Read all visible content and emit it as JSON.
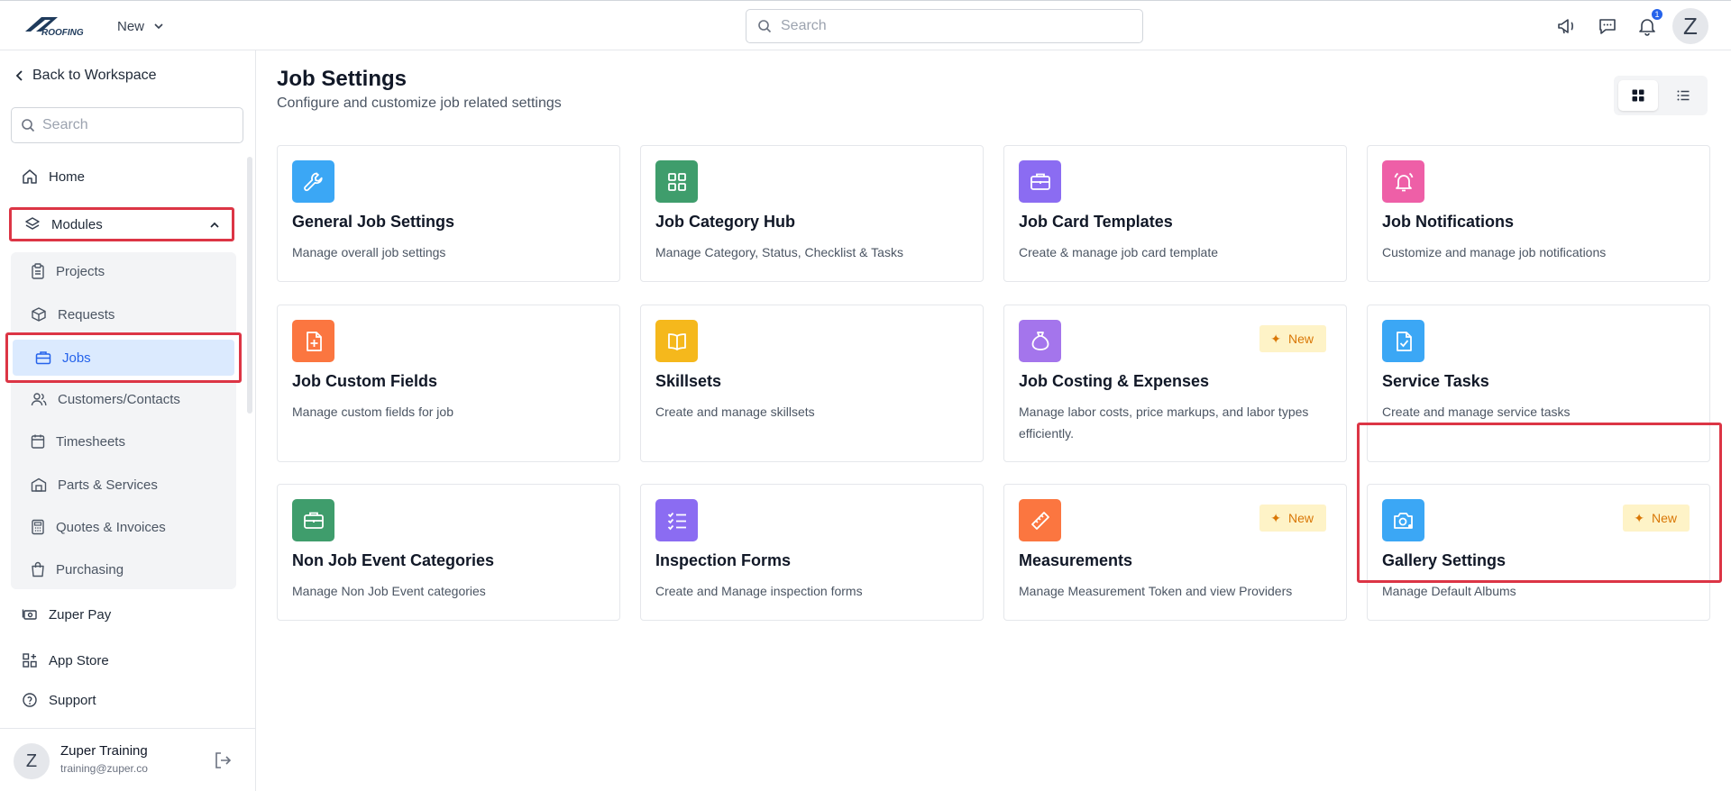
{
  "topbar": {
    "logo_text": "ROOFING",
    "new_label": "New",
    "search_placeholder": "Search",
    "notification_count": "1",
    "avatar_initial": "Z"
  },
  "sidebar": {
    "back_label": "Back to Workspace",
    "search_placeholder": "Search",
    "home_label": "Home",
    "modules_label": "Modules",
    "submenu": [
      {
        "label": "Projects",
        "icon": "clipboard-icon"
      },
      {
        "label": "Requests",
        "icon": "box-icon"
      },
      {
        "label": "Jobs",
        "icon": "briefcase-icon"
      },
      {
        "label": "Customers/Contacts",
        "icon": "users-icon"
      },
      {
        "label": "Timesheets",
        "icon": "calendar-icon"
      },
      {
        "label": "Parts & Services",
        "icon": "warehouse-icon"
      },
      {
        "label": "Quotes & Invoices",
        "icon": "calculator-icon"
      },
      {
        "label": "Purchasing",
        "icon": "shopping-bag-icon"
      }
    ],
    "zuper_pay_label": "Zuper Pay",
    "app_store_label": "App Store",
    "support_label": "Support",
    "user": {
      "initial": "Z",
      "name": "Zuper Training",
      "email": "training@zuper.co"
    }
  },
  "main": {
    "title": "Job Settings",
    "subtitle": "Configure and customize job related settings",
    "new_badge_label": "New",
    "cards": [
      {
        "title": "General Job Settings",
        "desc": "Manage overall job settings",
        "color": "#3ba7f5",
        "icon": "wrench-icon"
      },
      {
        "title": "Job Category Hub",
        "desc": "Manage Category, Status, Checklist & Tasks",
        "color": "#3f9d6c",
        "icon": "grid-icon"
      },
      {
        "title": "Job Card Templates",
        "desc": "Create & manage job card template",
        "color": "#8b6cf2",
        "icon": "briefcase-icon"
      },
      {
        "title": "Job Notifications",
        "desc": "Customize and manage job notifications",
        "color": "#ee5fa7",
        "icon": "alarm-bell-icon"
      },
      {
        "title": "Job Custom Fields",
        "desc": "Manage custom fields for job",
        "color": "#fb7640",
        "icon": "file-plus-icon"
      },
      {
        "title": "Skillsets",
        "desc": "Create and manage skillsets",
        "color": "#f5b81c",
        "icon": "book-icon"
      },
      {
        "title": "Job Costing & Expenses",
        "desc": "Manage labor costs, price markups, and labor types efficiently.",
        "color": "#a475ec",
        "icon": "money-bag-icon"
      },
      {
        "title": "Service Tasks",
        "desc": "Create and manage service tasks",
        "color": "#3ba7f5",
        "icon": "file-check-icon"
      },
      {
        "title": "Non Job Event Categories",
        "desc": "Manage Non Job Event categories",
        "color": "#3f9d6c",
        "icon": "briefcase-icon"
      },
      {
        "title": "Inspection Forms",
        "desc": "Create and Manage inspection forms",
        "color": "#8b6cf2",
        "icon": "checklist-icon"
      },
      {
        "title": "Measurements",
        "desc": "Manage Measurement Token and view Providers",
        "color": "#fb7640",
        "icon": "ruler-icon"
      },
      {
        "title": "Gallery Settings",
        "desc": "Manage Default Albums",
        "color": "#3ba7f5",
        "icon": "camera-gear-icon"
      }
    ]
  }
}
